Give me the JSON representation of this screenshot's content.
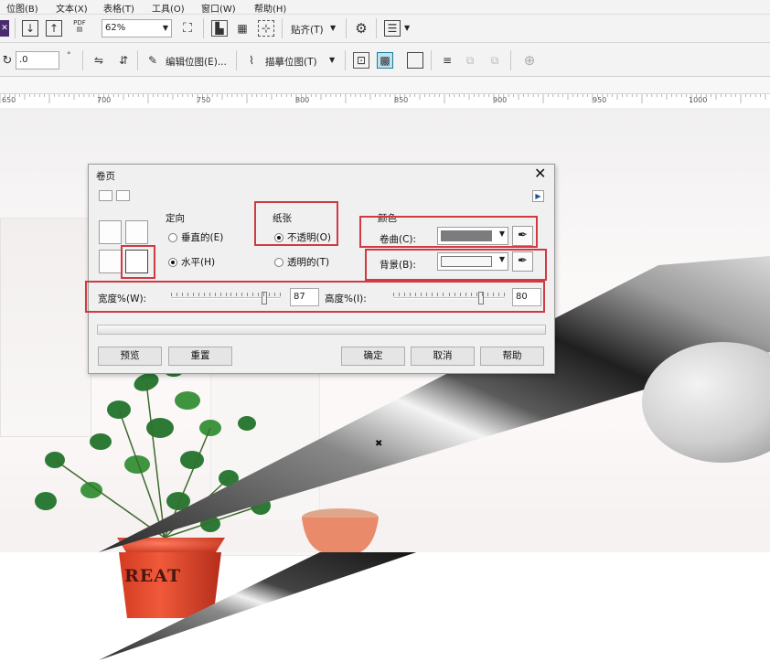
{
  "menu": [
    "位图(B)",
    "文本(X)",
    "表格(T)",
    "工具(O)",
    "窗口(W)",
    "帮助(H)"
  ],
  "toolbar1": {
    "pdf_label": "PDF",
    "zoom": "62%",
    "snap_label": "贴齐(T)"
  },
  "toolbar2": {
    "rotation_value": ".0",
    "edit_bitmap_label": "编辑位图(E)...",
    "trace_bitmap_label": "描摹位图(T)"
  },
  "ruler": {
    "labels": [
      "650",
      "700",
      "750",
      "800",
      "850",
      "900",
      "950",
      "1000"
    ]
  },
  "dialog": {
    "title": "卷页",
    "orientation": {
      "group_label": "定向",
      "vertical_label": "垂直的(E)",
      "horizontal_label": "水平(H)",
      "selected": "horizontal"
    },
    "paper": {
      "group_label": "纸张",
      "opaque_label": "不透明(O)",
      "transparent_label": "透明的(T)",
      "selected": "opaque"
    },
    "color": {
      "group_label": "颜色",
      "curl_label": "卷曲(C):",
      "curl_color": "#7c7b7d",
      "background_label": "背景(B):",
      "background_color": "#f6f6f6"
    },
    "width": {
      "label": "宽度%(W):",
      "value": "87",
      "level_percent": 87
    },
    "height": {
      "label": "高度%(I):",
      "value": "80",
      "level_percent": 80
    },
    "buttons": {
      "preview": "预览",
      "reset": "重置",
      "ok": "确定",
      "cancel": "取消",
      "help": "帮助"
    }
  },
  "photo": {
    "pot_text": "REAT"
  },
  "colors": {
    "accent_red": "#cf3a43",
    "toolbar_bg": "#f3f3f3",
    "dialog_bg": "#f0f0f0"
  }
}
